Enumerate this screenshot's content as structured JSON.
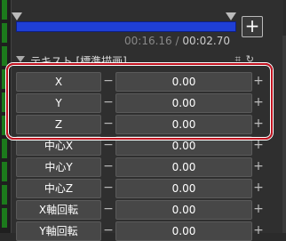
{
  "timeline": {
    "current_time": "00:16.16",
    "separator": " / ",
    "total_time": "00:02.70",
    "add_label": "+"
  },
  "header": {
    "title": "テキスト [標準描画]",
    "icons": [
      "film-icon",
      "refresh-icon"
    ]
  },
  "params": [
    {
      "label": "X",
      "value": "0.00"
    },
    {
      "label": "Y",
      "value": "0.00"
    },
    {
      "label": "Z",
      "value": "0.00"
    },
    {
      "label": "中心X",
      "value": "0.00"
    },
    {
      "label": "中心Y",
      "value": "0.00"
    },
    {
      "label": "中心Z",
      "value": "0.00"
    },
    {
      "label": "X軸回転",
      "value": "0.00"
    },
    {
      "label": "Y軸回転",
      "value": "0.00"
    }
  ],
  "controls": {
    "minus": "−",
    "plus": "+"
  },
  "colors": {
    "accent_highlight": "#c1121f",
    "timeline_bar": "#1f3fd6",
    "left_strip_green": "#1c7a1c"
  }
}
